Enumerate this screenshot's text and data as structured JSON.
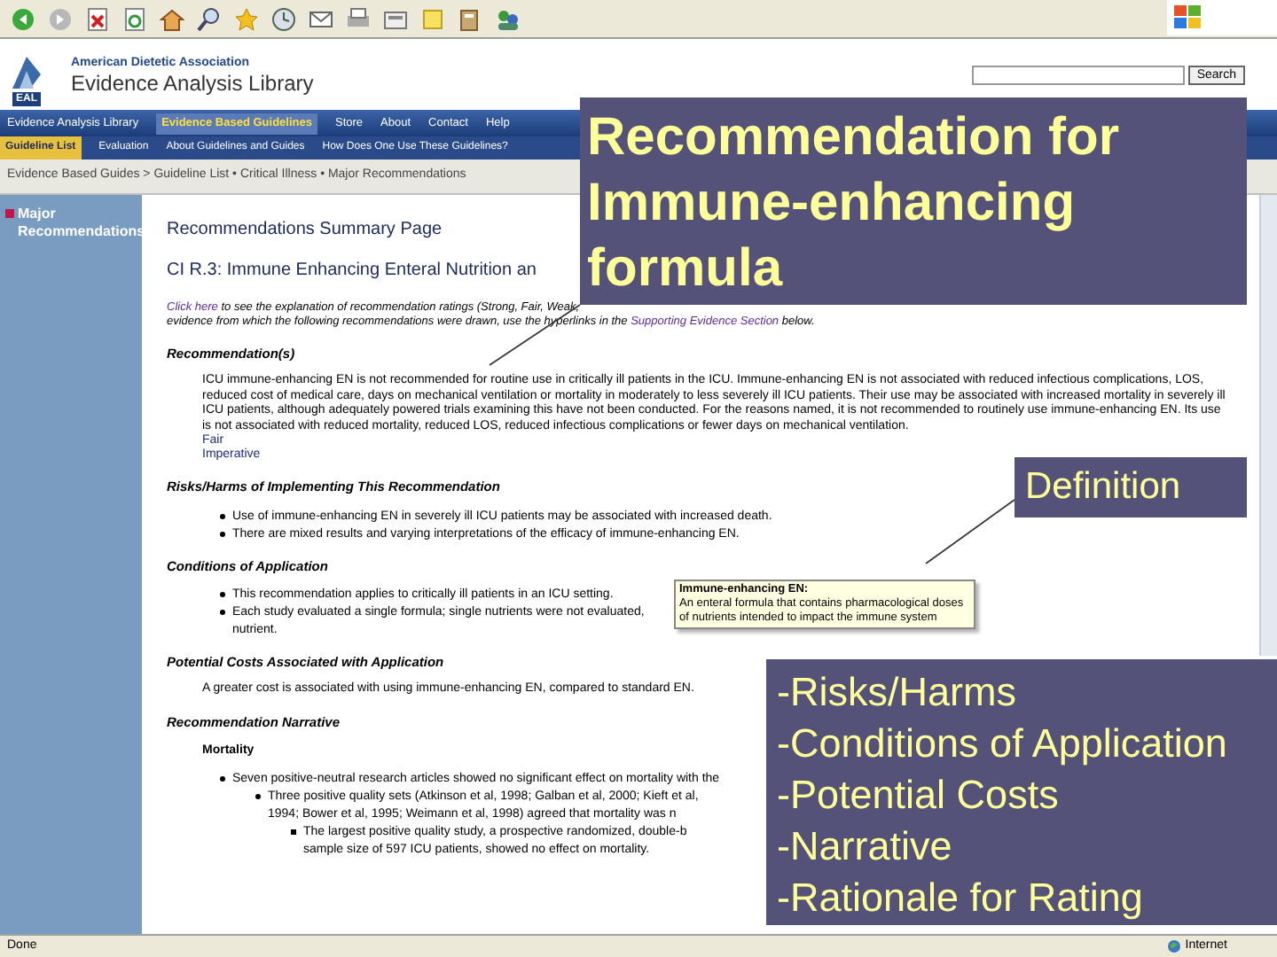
{
  "header": {
    "logo_text": "EAL",
    "org": "American Dietetic Association",
    "library": "Evidence Analysis Library",
    "search_button": "Search"
  },
  "nav": [
    {
      "label": "Evidence Analysis Library",
      "selected": false
    },
    {
      "label": "Evidence Based Guidelines",
      "selected": true
    },
    {
      "label": "Store",
      "selected": false
    },
    {
      "label": "About",
      "selected": false
    },
    {
      "label": "Contact",
      "selected": false
    },
    {
      "label": "Help",
      "selected": false
    }
  ],
  "subnav": [
    {
      "label": "Guideline List",
      "selected": true
    },
    {
      "label": "Evaluation",
      "selected": false
    },
    {
      "label": "About Guidelines and Guides",
      "selected": false
    },
    {
      "label": "How Does One Use These Guidelines?",
      "selected": false
    }
  ],
  "breadcrumb": "Evidence Based Guides > Guideline List • Critical Illness • Major Recommendations",
  "sidebar": {
    "items": [
      {
        "label": "Major Recommendations",
        "selected": true
      }
    ]
  },
  "content": [
    {
      "kind": "page_title",
      "text": "Recommendations Summary Page"
    },
    {
      "kind": "subtitle",
      "text": "CI R.3: Immune Enhancing Enteral Nutrition an"
    },
    {
      "kind": "intro",
      "parts": [
        {
          "text": "Click here",
          "link": true
        },
        {
          "text": " to see the explanation of recommendation ratings (Strong, Fair, Weak,",
          "link": false
        }
      ]
    },
    {
      "kind": "intro",
      "parts": [
        {
          "text": "evidence from which the following recommendations were drawn, use the hyperlinks in the ",
          "link": false
        },
        {
          "text": "Supporting Evidence Section",
          "link": true
        },
        {
          "text": " below.",
          "link": false
        }
      ]
    },
    {
      "kind": "heading",
      "text": "Recommendation(s)"
    },
    {
      "kind": "paragraph",
      "text": "ICU immune-enhancing EN is not recommended for routine use in critically ill patients in the ICU. Immune-enhancing EN is not associated with reduced infectious complications, LOS, reduced cost of medical care, days on mechanical ventilation or mortality in moderately to less severely ill ICU patients. Their use may be associated with increased mortality in severely ill ICU patients, although adequately powered trials examining this have not been conducted. For the reasons named, it is not recommended to routinely use immune-enhancing EN. Its use is not associated with reduced mortality, reduced LOS, reduced infectious complications or fewer days on mechanical ventilation."
    },
    {
      "kind": "rating",
      "text": "Fair"
    },
    {
      "kind": "rating",
      "text": "Imperative"
    },
    {
      "kind": "heading",
      "text": "Risks/Harms of Implementing This Recommendation"
    },
    {
      "kind": "bullets",
      "items": [
        {
          "text": "Use of immune-enhancing EN in severely ill ICU patients may be associated with increased death."
        },
        {
          "text": "There are mixed results and varying interpretations of the efficacy of immune-enhancing EN."
        }
      ]
    },
    {
      "kind": "heading",
      "text": "Conditions of Application"
    },
    {
      "kind": "bullets",
      "items": [
        {
          "text": "This recommendation applies to critically ill patients in an ICU setting."
        },
        {
          "text": "Each study evaluated a single formula; single nutrients were not evaluated,"
        },
        {
          "text": "nutrient.",
          "continuation": true
        }
      ]
    },
    {
      "kind": "heading",
      "text": "Potential Costs Associated with Application"
    },
    {
      "kind": "paragraph",
      "text": "A greater cost is associated with using immune-enhancing EN, compared to standard EN."
    },
    {
      "kind": "heading",
      "text": "Recommendation Narrative"
    },
    {
      "kind": "subheading",
      "text": "Mortality"
    },
    {
      "kind": "bullets",
      "items": [
        {
          "text": "Seven positive-neutral research articles showed no significant effect on mortality with the",
          "children": [
            {
              "text": "Three positive quality sets (Atkinson et al, 1998; Galban et al, 2000; Kieft et al,",
              "continuation_text": "1994; Bower et al, 1995; Weimann et al, 1998) agreed that mortality was n",
              "children": [
                {
                  "text": "The largest positive quality study, a prospective randomized, double-b",
                  "continuation_text": "sample size of 597 ICU patients, showed no effect on mortality."
                }
              ]
            }
          ]
        }
      ]
    }
  ],
  "tooltip": {
    "title": "Immune-enhancing EN:",
    "body": "An enteral formula that contains pharmacological doses of nutrients intended to impact the immune system"
  },
  "callouts": [
    {
      "kind": "title",
      "lines": [
        "Recommendation for",
        "Immune-enhancing",
        "formula"
      ]
    },
    {
      "kind": "label",
      "lines": [
        "Definition"
      ]
    },
    {
      "kind": "list",
      "lines": [
        "-Risks/Harms",
        "-Conditions of Application",
        "-Potential Costs",
        "-Narrative",
        "-Rationale for Rating"
      ]
    }
  ],
  "status_bar": {
    "state": "Done",
    "zone": "Internet"
  }
}
